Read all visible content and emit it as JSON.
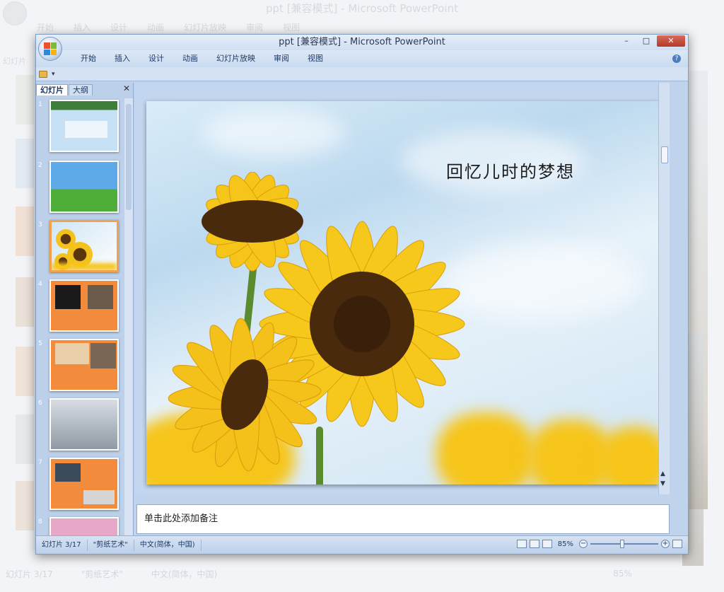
{
  "background_window": {
    "title": "ppt [兼容模式] - Microsoft PowerPoint",
    "tabs": [
      "开始",
      "插入",
      "设计",
      "动画",
      "幻灯片放映",
      "审阅",
      "视图"
    ],
    "panel_tab": "幻灯片",
    "status_slide": "幻灯片 3/17",
    "status_theme": "\"剪纸艺术\"",
    "status_lang": "中文(简体，中国)",
    "zoom": "85%"
  },
  "window": {
    "title": "ppt [兼容模式] - Microsoft PowerPoint",
    "controls": {
      "minimize": "–",
      "maximize": "□",
      "close": "✕"
    }
  },
  "ribbon": {
    "tabs": [
      "开始",
      "插入",
      "设计",
      "动画",
      "幻灯片放映",
      "审阅",
      "视图"
    ],
    "help": "?"
  },
  "qat": {
    "more": "▾"
  },
  "slides_panel": {
    "tabs": [
      "幻灯片",
      "大纲"
    ],
    "close": "✕",
    "slides": [
      {
        "num": "1"
      },
      {
        "num": "2"
      },
      {
        "num": "3"
      },
      {
        "num": "4"
      },
      {
        "num": "5"
      },
      {
        "num": "6"
      },
      {
        "num": "7"
      },
      {
        "num": "8"
      }
    ],
    "selected": 3
  },
  "slide": {
    "title": "回忆儿时的梦想"
  },
  "scrollbar": {
    "prev_slide": "▲",
    "next_slide": "▼"
  },
  "notes": {
    "placeholder": "单击此处添加备注"
  },
  "status": {
    "slide_info": "幻灯片 3/17",
    "theme": "\"剪纸艺术\"",
    "language": "中文(简体，中国)",
    "zoom": "85%",
    "zoom_out": "−",
    "zoom_in": "+",
    "zoom_fraction": 0.47
  },
  "colors": {
    "ribbon": "#c9dbf0",
    "selected_thumb": "#f2a24a",
    "sunflower_petal": "#f6c51a",
    "sunflower_center": "#4a2a0c"
  }
}
